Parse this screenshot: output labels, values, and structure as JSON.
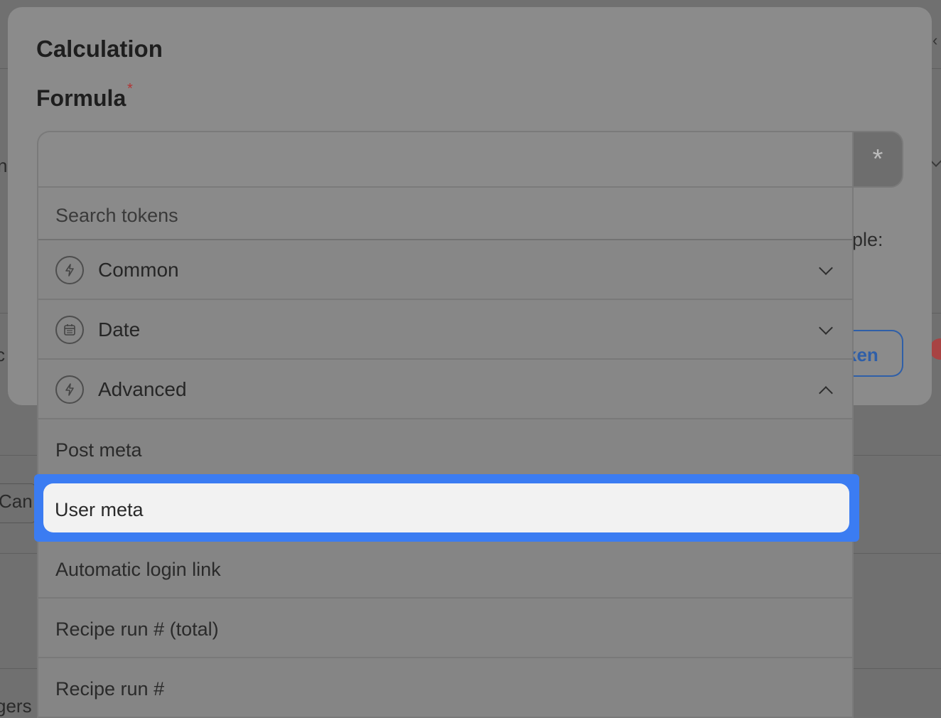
{
  "modal": {
    "title": "Calculation",
    "field_label": "Formula",
    "required_mark": "*",
    "token_button_symbol": "*",
    "behind_text": "ple:",
    "behind_button": "ken"
  },
  "background": {
    "left_fragments": [
      "n",
      "c",
      "Can",
      "gers"
    ]
  },
  "dropdown": {
    "search_placeholder": "Search tokens",
    "categories": [
      {
        "label": "Common",
        "icon": "bolt-icon",
        "expanded": false
      },
      {
        "label": "Date",
        "icon": "calendar-icon",
        "expanded": false
      },
      {
        "label": "Advanced",
        "icon": "bolt-icon",
        "expanded": true
      }
    ],
    "items": [
      {
        "label": "Post meta"
      },
      {
        "label": "User meta",
        "highlighted": true
      },
      {
        "label": "Automatic login link"
      },
      {
        "label": "Recipe run # (total)"
      },
      {
        "label": "Recipe run #"
      }
    ]
  },
  "colors": {
    "highlight": "#3b7cf2",
    "required": "#b33434",
    "link": "#2f5fa8"
  }
}
